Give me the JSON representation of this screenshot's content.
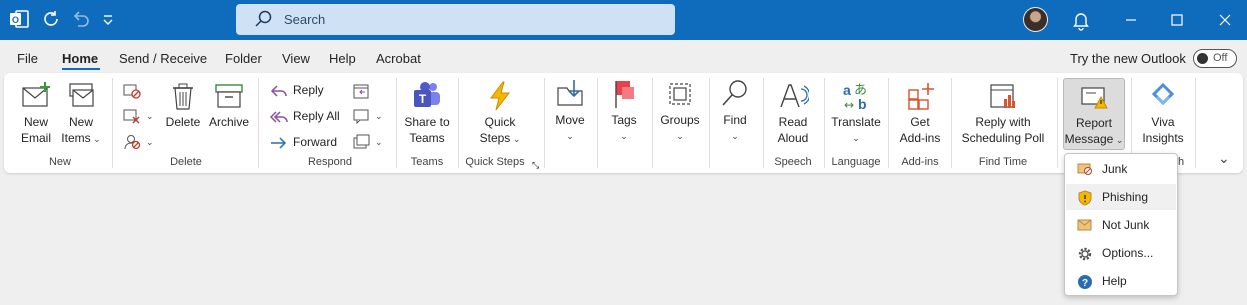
{
  "titlebar": {
    "search_placeholder": "Search",
    "brand_color": "#0f6cbd"
  },
  "menu": {
    "items": [
      "File",
      "Home",
      "Send / Receive",
      "Folder",
      "View",
      "Help",
      "Acrobat"
    ],
    "active": "Home",
    "try_new": "Try the new Outlook",
    "toggle_state": "Off"
  },
  "ribbon": {
    "new_email": [
      "New",
      "Email"
    ],
    "new_items": [
      "New",
      "Items"
    ],
    "group_new": "New",
    "delete": "Delete",
    "archive": "Archive",
    "group_delete": "Delete",
    "reply": "Reply",
    "reply_all": "Reply All",
    "forward": "Forward",
    "group_respond": "Respond",
    "share_teams": [
      "Share to",
      "Teams"
    ],
    "group_teams": "Teams",
    "quick_steps": [
      "Quick",
      "Steps"
    ],
    "group_quick_steps": "Quick Steps",
    "move": "Move",
    "tags": "Tags",
    "groups": "Groups",
    "find": "Find",
    "read_aloud": [
      "Read",
      "Aloud"
    ],
    "group_speech": "Speech",
    "translate": "Translate",
    "group_language": "Language",
    "get_addins": [
      "Get",
      "Add-ins"
    ],
    "group_addins": "Add-ins",
    "reply_poll": [
      "Reply with",
      "Scheduling Poll"
    ],
    "group_find_time": "Find Time",
    "report_message": [
      "Report",
      "Message"
    ],
    "viva": [
      "Viva",
      "Insights"
    ],
    "group_partial": "h"
  },
  "report_menu": {
    "items": [
      "Junk",
      "Phishing",
      "Not Junk",
      "Options...",
      "Help"
    ],
    "hovered": "Phishing"
  }
}
